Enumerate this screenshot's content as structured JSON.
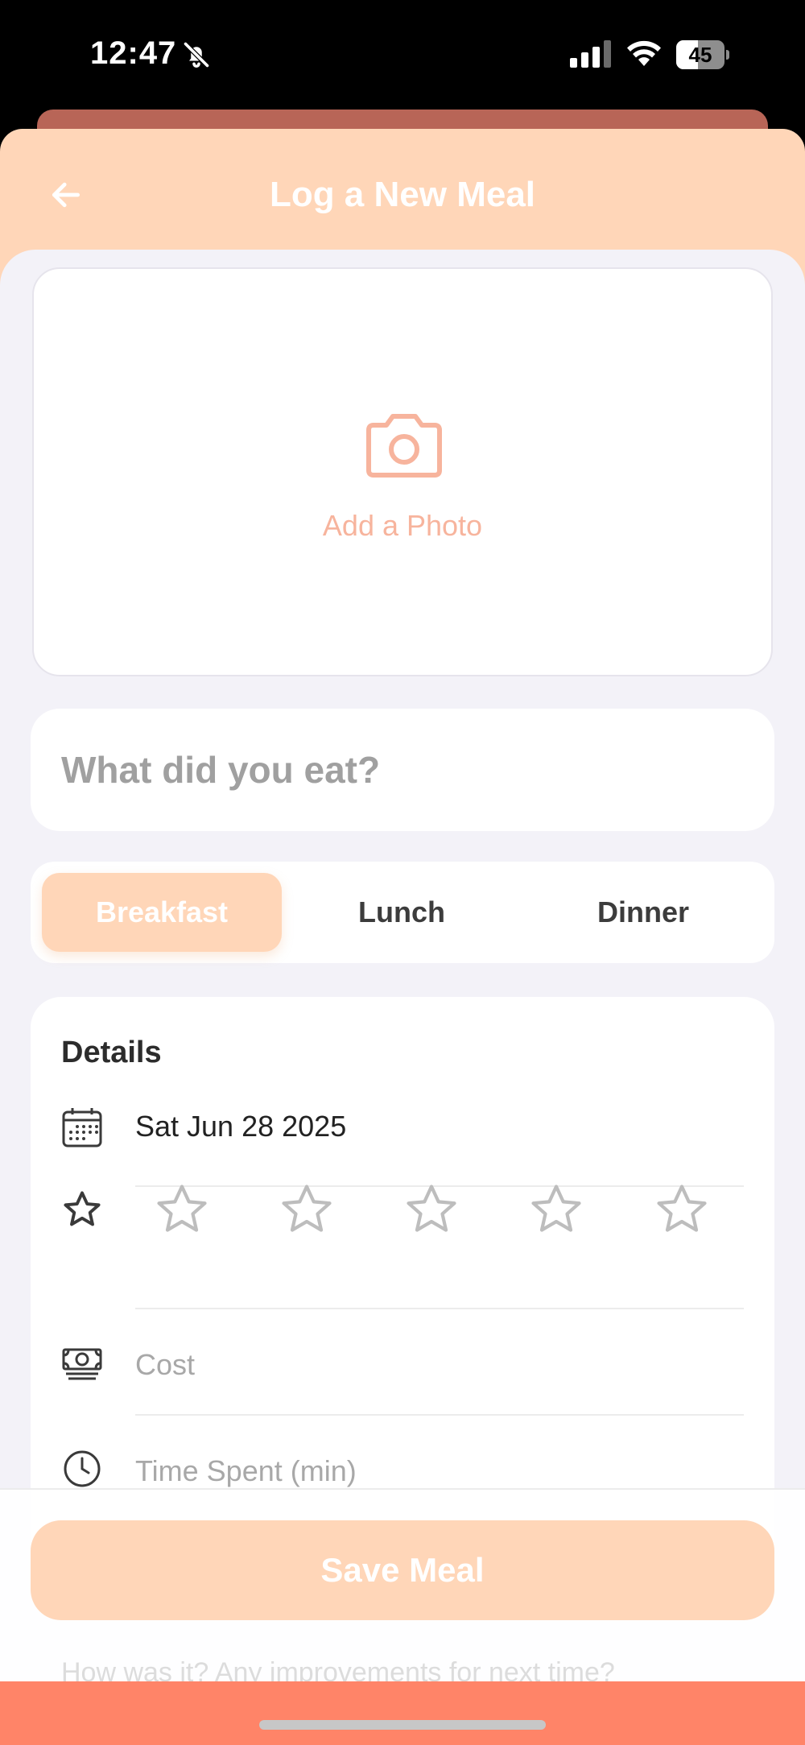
{
  "status_bar": {
    "time": "12:47",
    "battery": "45",
    "battery_level": 0.45,
    "icons": [
      "bell-slash-icon",
      "cellular-signal-icon",
      "wifi-icon",
      "battery-icon"
    ]
  },
  "header": {
    "title": "Log a New Meal",
    "back_icon": "arrow-left-icon",
    "background_color": "#ffd6b8"
  },
  "photo": {
    "label": "Add a Photo",
    "icon": "camera-icon",
    "accent_color": "#f7b49d"
  },
  "meal_input": {
    "placeholder": "What did you eat?",
    "value": ""
  },
  "meal_types": {
    "options": [
      "Breakfast",
      "Lunch",
      "Dinner"
    ],
    "selected": "Breakfast"
  },
  "details": {
    "title": "Details",
    "date": "Sat Jun 28 2025",
    "date_icon": "calendar-icon",
    "rating_icon": "star-icon",
    "rating": 0,
    "rating_max": 5,
    "cost_placeholder": "Cost",
    "cost_icon": "money-icon",
    "time_placeholder": "Time Spent (min)",
    "time_icon": "clock-icon"
  },
  "notes": {
    "placeholder": "How was it? Any improvements for next time?"
  },
  "save_button": {
    "label": "Save Meal",
    "color": "#ffd6b8"
  },
  "colors": {
    "bottom_bar": "#ff8468",
    "background": "#f3f2f8"
  }
}
